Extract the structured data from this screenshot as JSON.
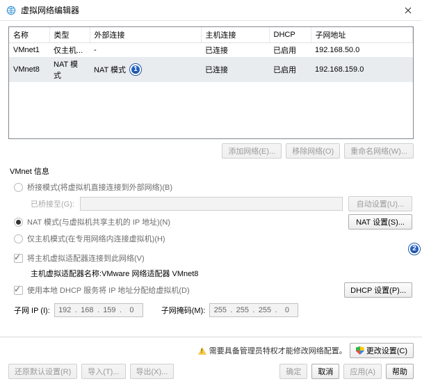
{
  "window": {
    "title": "虚拟网络编辑器"
  },
  "table": {
    "headers": [
      "名称",
      "类型",
      "外部连接",
      "主机连接",
      "DHCP",
      "子网地址"
    ],
    "rows": [
      {
        "name": "VMnet1",
        "type": "仅主机...",
        "ext": "-",
        "host": "已连接",
        "dhcp": "已启用",
        "subnet": "192.168.50.0",
        "selected": false,
        "badge": null
      },
      {
        "name": "VMnet8",
        "type": "NAT 模式",
        "ext": "NAT 模式",
        "host": "已连接",
        "dhcp": "已启用",
        "subnet": "192.168.159.0",
        "selected": true,
        "badge": "1"
      }
    ],
    "buttons": {
      "add": "添加网络(E)...",
      "remove": "移除网络(O)",
      "rename": "重命名网络(W)..."
    }
  },
  "group": {
    "legend": "VMnet 信息",
    "bridged": {
      "label": "桥接模式(将虚拟机直接连接到外部网络)(B)"
    },
    "bridgedTo": {
      "label": "已桥接至(G):",
      "btn": "自动设置(U)..."
    },
    "nat": {
      "label": "NAT 模式(与虚拟机共享主机的 IP 地址)(N)",
      "btn": "NAT 设置(S)..."
    },
    "hostonly": {
      "label": "仅主机模式(在专用网络内连接虚拟机)(H)"
    },
    "hostAdapter": {
      "label": "将主机虚拟适配器连接到此网络(V)"
    },
    "hostAdapterName": {
      "prefix": "主机虚拟适配器名称: ",
      "value": "VMware 网络适配器 VMnet8"
    },
    "dhcp": {
      "label": "使用本地 DHCP 服务将 IP 地址分配给虚拟机(D)",
      "btn": "DHCP 设置(P)..."
    },
    "subnetIp": {
      "label": "子网 IP (I):",
      "value": [
        "192",
        "168",
        "159",
        "0"
      ]
    },
    "subnetMask": {
      "label": "子网掩码(M):",
      "value": [
        "255",
        "255",
        "255",
        "0"
      ]
    }
  },
  "footer": {
    "note": "需要具备管理员特权才能修改网络配置。",
    "change": "更改设置(C)",
    "restore": "还原默认设置(R)",
    "import": "导入(T)...",
    "export": "导出(X)...",
    "ok": "确定",
    "cancel": "取消",
    "apply": "应用(A)",
    "help": "帮助"
  },
  "badges": {
    "two": "2"
  }
}
